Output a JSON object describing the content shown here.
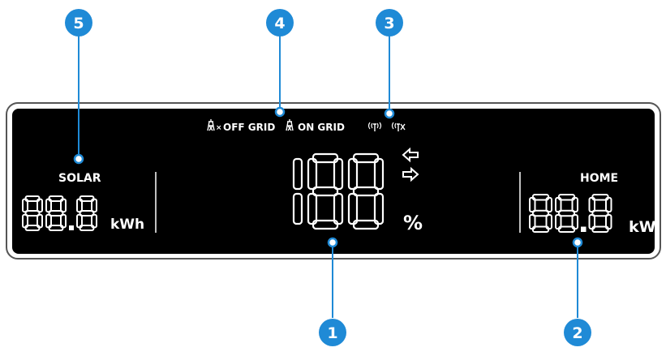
{
  "display": {
    "solar_label": "SOLAR",
    "solar_value": "88.8",
    "solar_unit": "kWh",
    "home_label": "HOME",
    "home_value": "88.8",
    "home_unit": "kW",
    "battery_value": "188",
    "battery_unit": "%",
    "off_grid_label": "OFF GRID",
    "on_grid_label": "ON GRID",
    "signal_glyph": "((ᴛ))",
    "signal_off_glyph": "((ᴛ✕"
  },
  "callouts": [
    {
      "number": "1",
      "color": "#1f8ad6"
    },
    {
      "number": "2",
      "color": "#1f8ad6"
    },
    {
      "number": "3",
      "color": "#1f8ad6"
    },
    {
      "number": "4",
      "color": "#1f8ad6"
    },
    {
      "number": "5",
      "color": "#1f8ad6"
    }
  ],
  "colors": {
    "panel": "#000000",
    "bezel": "#4a4a4a",
    "segment": "#ffffff",
    "accent": "#1f8ad6"
  }
}
